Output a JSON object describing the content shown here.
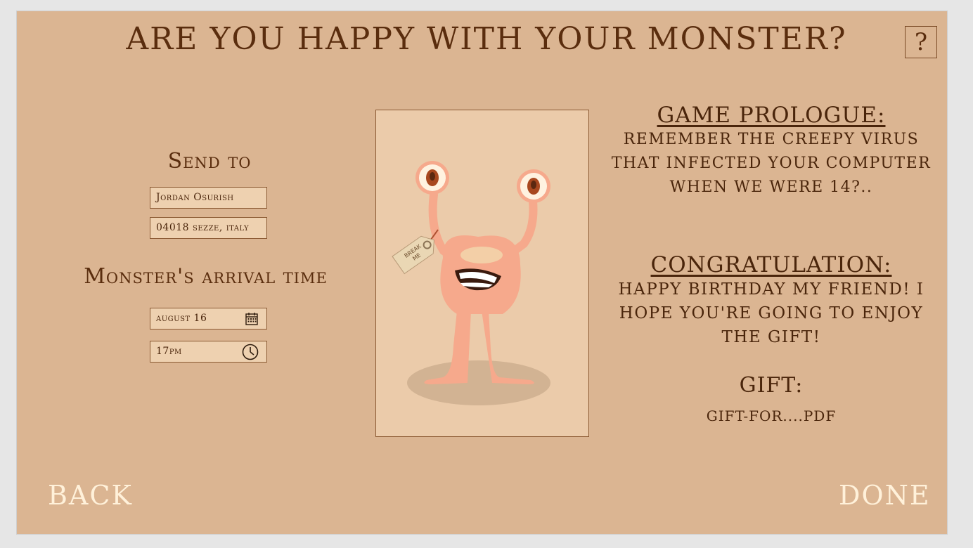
{
  "header": {
    "title": "ARE YOU HAPPY WITH YOUR MONSTER?",
    "help_label": "?"
  },
  "send_to": {
    "heading": "Send to",
    "name_value": "Jordan Osurish",
    "address_value": "04018 sezze, italy"
  },
  "arrival": {
    "heading": "Monster's arrival time",
    "date_value": "august 16",
    "time_value": "17pm",
    "date_icon": "calendar-icon",
    "time_icon": "clock-icon"
  },
  "card": {
    "tag_text_1": "BREAK",
    "tag_text_2": "ME"
  },
  "prologue": {
    "heading": "GAME PROLOGUE:",
    "body": "REMEMBER THE CREEPY VIRUS THAT INFECTED YOUR COMPUTER WHEN WE WERE 14?.."
  },
  "congratulation": {
    "heading": "CONGRATULATION:",
    "body": "HAPPY BIRTHDAY MY FRIEND! I HOPE YOU'RE GOING TO ENJOY THE GIFT!"
  },
  "gift": {
    "heading": "GIFT:",
    "file_name": "GIFT-FOR....PDF"
  },
  "footer": {
    "back_label": "BACK",
    "done_label": "DONE"
  },
  "colors": {
    "background": "#dbb592",
    "text_dark": "#5a2d0e",
    "nav_text": "#fff1da",
    "card": "#ebcbaa"
  }
}
